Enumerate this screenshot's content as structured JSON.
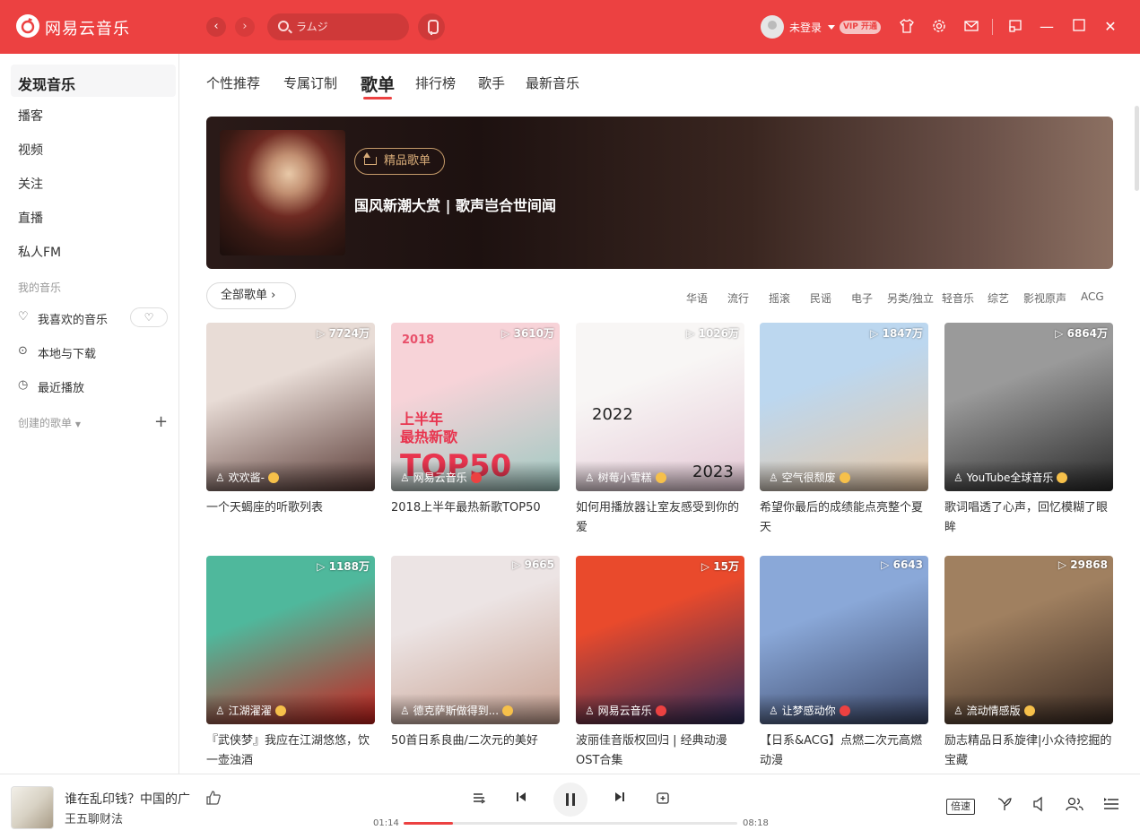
{
  "app": {
    "title": "网易云音乐",
    "search_placeholder": "ラムジ",
    "user": "未登录",
    "vip": "开通",
    "vip_prefix": "VIP"
  },
  "sidebar": {
    "discover": "发现音乐",
    "items": [
      "播客",
      "视频",
      "关注",
      "直播",
      "私人FM"
    ],
    "my_music_header": "我的音乐",
    "my_music": [
      {
        "label": "我喜欢的音乐",
        "icon": "heart-icon"
      },
      {
        "label": "本地与下载",
        "icon": "download-icon"
      },
      {
        "label": "最近播放",
        "icon": "clock-icon"
      }
    ],
    "created_header": "创建的歌单"
  },
  "tabs": [
    "个性推荐",
    "专属订制",
    "歌单",
    "排行榜",
    "歌手",
    "最新音乐"
  ],
  "active_tab": "歌单",
  "banner": {
    "tag": "精品歌单",
    "title": "国风新潮大赏 | 歌声岂合世间闻"
  },
  "filter": {
    "all": "全部歌单",
    "categories": [
      "华语",
      "流行",
      "摇滚",
      "民谣",
      "电子",
      "另类/独立",
      "轻音乐",
      "综艺",
      "影视原声",
      "ACG"
    ]
  },
  "playlists": [
    {
      "count": "7724万",
      "creator": "欢欢酱-",
      "badge": "gold",
      "title": "一个天蝎座的听歌列表",
      "colors": [
        "#e8dcd6",
        "#5a3b36"
      ]
    },
    {
      "count": "3610万",
      "creator": "网易云音乐",
      "badge": "red",
      "title": "2018上半年最热新歌TOP50",
      "colors": [
        "#f7d3d8",
        "#9fc9c2"
      ],
      "overlay_text": [
        "2018",
        "上半年",
        "最热新歌",
        "TOP50"
      ]
    },
    {
      "count": "1026万",
      "creator": "树莓小雪糕",
      "badge": "gold",
      "title": "如何用播放器让室友感受到你的爱",
      "colors": [
        "#f8f6f5",
        "#e5c9d6"
      ],
      "overlay_text": [
        "2022",
        "2023"
      ]
    },
    {
      "count": "1847万",
      "creator": "空气很颓废",
      "badge": "gold",
      "title": "希望你最后的成绩能点亮整个夏天",
      "colors": [
        "#bcd7ef",
        "#e8c7a4"
      ]
    },
    {
      "count": "6864万",
      "creator": "YouTube全球音乐",
      "badge": "gold",
      "title": "歌词唱透了心声，回忆模糊了眼眸",
      "colors": [
        "#9a9a9a",
        "#2a2a2a"
      ]
    },
    {
      "count": "1188万",
      "creator": "江湖濯濯",
      "badge": "gold",
      "title": "『武侠梦』我应在江湖悠悠，饮一壶浊酒",
      "colors": [
        "#4fb89c",
        "#c8201c"
      ]
    },
    {
      "count": "9665",
      "creator": "德克萨斯做得到...",
      "badge": "gold",
      "title": "50首日系良曲/二次元的美好",
      "colors": [
        "#ece4e4",
        "#c7a090"
      ]
    },
    {
      "count": "15万",
      "creator": "网易云音乐",
      "badge": "red",
      "title": "波丽佳音版权回归 | 经典动漫OST合集",
      "colors": [
        "#e94a2c",
        "#2a2a5a"
      ]
    },
    {
      "count": "6643",
      "creator": "让梦感动你",
      "badge": "red",
      "title": "【日系&ACG】点燃二次元高燃动漫",
      "colors": [
        "#8aa8d8",
        "#3a4668"
      ]
    },
    {
      "count": "29868",
      "creator": "流动情感版",
      "badge": "gold",
      "title": "励志精品日系旋律|小众待挖掘的宝藏",
      "colors": [
        "#a08060",
        "#3a2a22"
      ]
    }
  ],
  "player": {
    "song": "谁在乱印钱？中国的广",
    "artist": "王五聊财法",
    "elapsed": "01:14",
    "total": "08:18",
    "progress": 0.148,
    "speed": "倍速"
  },
  "colors": {
    "accent": "#ec4141"
  }
}
